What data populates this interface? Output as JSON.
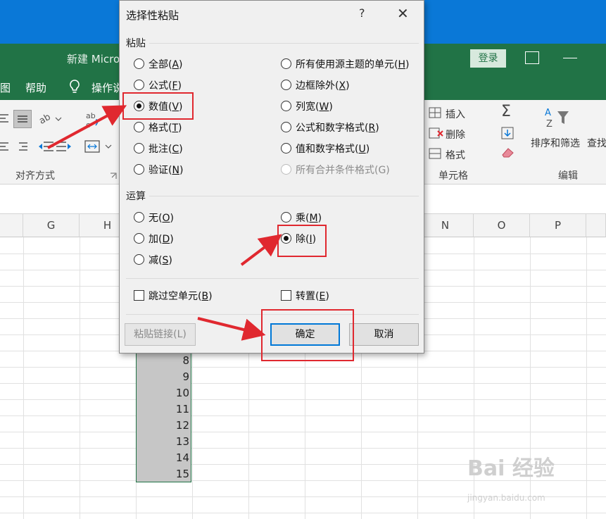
{
  "excel": {
    "window_title": "新建 Micro",
    "login_button": "登录",
    "tabs": [
      "图",
      "帮助",
      "操作说"
    ],
    "ribbon": {
      "align_group_label": "对齐方式",
      "cells_group_label": "单元格",
      "cells_insert": "插入",
      "cells_delete": "删除",
      "cells_format": "格式",
      "editing_group_label": "编辑",
      "sort_filter": "排序和筛选",
      "find": "查找",
      "sigma": "Σ"
    },
    "columns": [
      "G",
      "H",
      "N",
      "O",
      "P"
    ],
    "cell_values": [
      "8",
      "9",
      "10",
      "11",
      "12",
      "13",
      "14",
      "15"
    ]
  },
  "dialog": {
    "title": "选择性粘贴",
    "help": "?",
    "close": "✕",
    "paste_section": "粘贴",
    "paste_options_left": [
      {
        "label": "全部(",
        "key": "A",
        "end": ")",
        "selected": false
      },
      {
        "label": "公式(",
        "key": "F",
        "end": ")",
        "selected": false
      },
      {
        "label": "数值(",
        "key": "V",
        "end": ")",
        "selected": true
      },
      {
        "label": "格式(",
        "key": "T",
        "end": ")",
        "selected": false
      },
      {
        "label": "批注(",
        "key": "C",
        "end": ")",
        "selected": false
      },
      {
        "label": "验证(",
        "key": "N",
        "end": ")",
        "selected": false
      }
    ],
    "paste_options_right": [
      {
        "label": "所有使用源主题的单元(",
        "key": "H",
        "end": ")",
        "selected": false
      },
      {
        "label": "边框除外(",
        "key": "X",
        "end": ")",
        "selected": false
      },
      {
        "label": "列宽(",
        "key": "W",
        "end": ")",
        "selected": false
      },
      {
        "label": "公式和数字格式(",
        "key": "R",
        "end": ")",
        "selected": false
      },
      {
        "label": "值和数字格式(",
        "key": "U",
        "end": ")",
        "selected": false
      },
      {
        "label": "所有合并条件格式(G)",
        "key": "",
        "end": "",
        "selected": false,
        "disabled": true
      }
    ],
    "operation_section": "运算",
    "operation_options_left": [
      {
        "label": "无(",
        "key": "O",
        "end": ")",
        "selected": false
      },
      {
        "label": "加(",
        "key": "D",
        "end": ")",
        "selected": false
      },
      {
        "label": "减(",
        "key": "S",
        "end": ")",
        "selected": false
      }
    ],
    "operation_options_right": [
      {
        "label": "乘(",
        "key": "M",
        "end": ")",
        "selected": false
      },
      {
        "label": "除(",
        "key": "I",
        "end": ")",
        "selected": true
      }
    ],
    "skip_blanks": {
      "label": "跳过空单元(",
      "key": "B",
      "end": ")",
      "checked": false
    },
    "transpose": {
      "label": "转置(",
      "key": "E",
      "end": ")",
      "checked": false
    },
    "paste_link_button": "粘贴链接(L)",
    "ok_button": "确定",
    "cancel_button": "取消"
  },
  "watermark": {
    "main": "Bai 经验",
    "sub": "jingyan.baidu.com"
  },
  "colors": {
    "excel_green": "#217346",
    "windows_blue": "#0a78d7",
    "annotation_red": "#e0282f",
    "ok_border": "#0078d7"
  }
}
